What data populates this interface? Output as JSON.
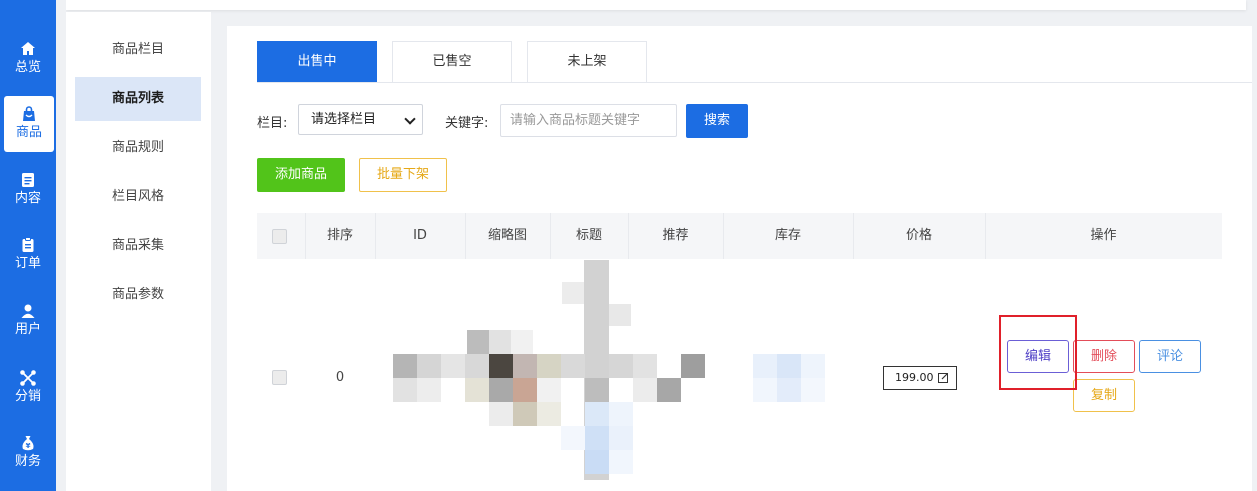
{
  "sidebar": {
    "items": [
      {
        "label": "总览",
        "icon": "home-icon"
      },
      {
        "label": "商品",
        "icon": "shopping-bag-icon"
      },
      {
        "label": "内容",
        "icon": "document-icon"
      },
      {
        "label": "订单",
        "icon": "clipboard-icon"
      },
      {
        "label": "用户",
        "icon": "user-icon"
      },
      {
        "label": "分销",
        "icon": "share-network-icon"
      },
      {
        "label": "财务",
        "icon": "money-bag-icon"
      }
    ],
    "active_index": 1
  },
  "subnav": {
    "items": [
      {
        "label": "商品栏目"
      },
      {
        "label": "商品列表"
      },
      {
        "label": "商品规则"
      },
      {
        "label": "栏目风格"
      },
      {
        "label": "商品采集"
      },
      {
        "label": "商品参数"
      }
    ],
    "active_index": 1
  },
  "tabs": [
    {
      "label": "出售中"
    },
    {
      "label": "已售空"
    },
    {
      "label": "未上架"
    }
  ],
  "filter": {
    "category_label": "栏目:",
    "category_value": "请选择栏目",
    "keyword_label": "关键字:",
    "keyword_placeholder": "请输入商品标题关键字",
    "search_label": "搜索"
  },
  "actions": {
    "add_label": "添加商品",
    "batch_label": "批量下架"
  },
  "table": {
    "columns": [
      "排序",
      "ID",
      "缩略图",
      "标题",
      "推荐",
      "库存",
      "价格",
      "操作"
    ],
    "rows": [
      {
        "sort": "0",
        "price": "199.00",
        "ops": {
          "edit": "编辑",
          "delete": "删除",
          "comment": "评论",
          "copy": "复制"
        }
      }
    ]
  },
  "colors": {
    "primary": "#1c6de3",
    "success": "#52c41a",
    "warning": "#e6a817",
    "danger": "#e34d59",
    "highlight": "#e0202a"
  }
}
